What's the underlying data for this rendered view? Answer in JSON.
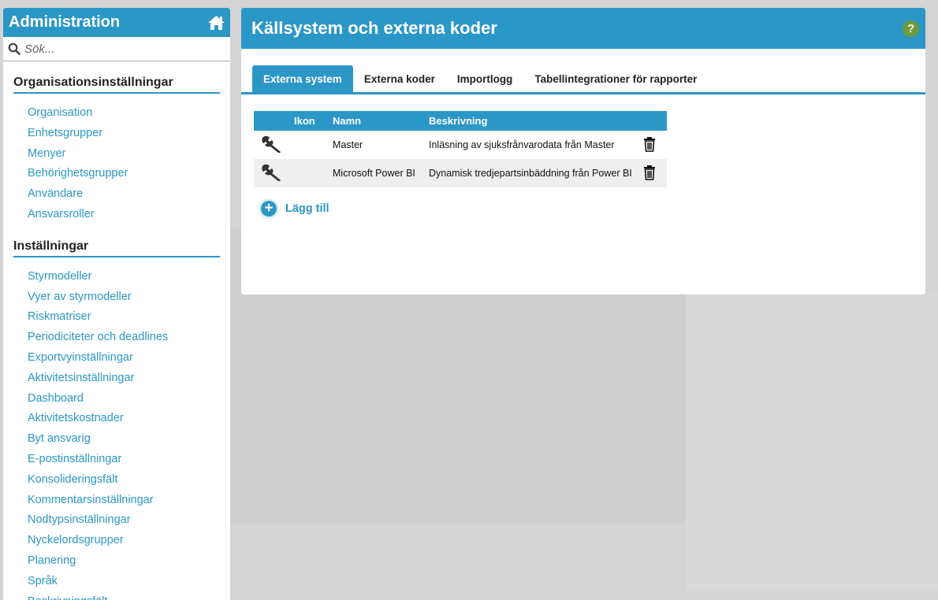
{
  "sidebar": {
    "title": "Administration",
    "home_icon": "home-icon",
    "search": {
      "placeholder": "Sök...",
      "value": ""
    },
    "sections": [
      {
        "heading": "Organisationsinställningar",
        "items": [
          "Organisation",
          "Enhetsgrupper",
          "Menyer",
          "Behörighetsgrupper",
          "Användare",
          "Ansvarsroller"
        ]
      },
      {
        "heading": "Inställningar",
        "items": [
          "Styrmodeller",
          "Vyer av styrmodeller",
          "Riskmatriser",
          "Periodiciteter och deadlines",
          "Exportvyinställningar",
          "Aktivitetsinställningar",
          "Dashboard",
          "Aktivitetskostnader",
          "Byt ansvarig",
          "E-postinställningar",
          "Konsolideringsfält",
          "Kommentarsinställningar",
          "Nodtypsinställningar",
          "Nyckelordsgrupper",
          "Planering",
          "Språk",
          "Beskrivningsfält"
        ]
      }
    ]
  },
  "main": {
    "title": "Källsystem och externa koder",
    "help_label": "?",
    "tabs": [
      {
        "label": "Externa system",
        "active": true
      },
      {
        "label": "Externa koder",
        "active": false
      },
      {
        "label": "Importlogg",
        "active": false
      },
      {
        "label": "Tabellintegrationer för rapporter",
        "active": false
      }
    ],
    "table": {
      "columns": [
        "",
        "Ikon",
        "Namn",
        "Beskrivning",
        ""
      ],
      "rows": [
        {
          "icon": "wrench-icon",
          "name": "Master",
          "description": "Inläsning av sjuksfrånvarodata från Master"
        },
        {
          "icon": "wrench-icon",
          "name": "Microsoft Power BI",
          "description": "Dynamisk tredjepartsinbäddning från Power BI"
        }
      ]
    },
    "add_label": "Lägg till"
  },
  "colors": {
    "accent": "#2b97c6",
    "help": "#6d9a3a",
    "background": "#d4d4d4"
  }
}
